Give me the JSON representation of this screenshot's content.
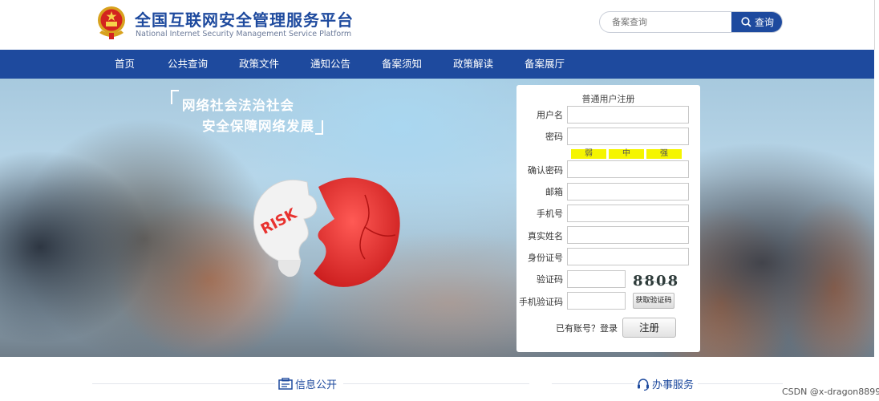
{
  "header": {
    "title": "全国互联网安全管理服务平台",
    "subtitle": "National Internet Security Management Service Platform",
    "search_placeholder": "备案查询",
    "search_button": "查询"
  },
  "nav": {
    "items": [
      "首页",
      "公共查询",
      "政策文件",
      "通知公告",
      "备案须知",
      "政策解读",
      "备案展厅"
    ]
  },
  "hero": {
    "slogan_line1": "网络社会法治社会",
    "slogan_line2": "安全保障网络发展",
    "puzzle_text": "RISK"
  },
  "register_form": {
    "title": "普通用户注册",
    "labels": {
      "username": "用户名",
      "password": "密码",
      "confirm_password": "确认密码",
      "email": "邮箱",
      "phone": "手机号",
      "real_name": "真实姓名",
      "id_number": "身份证号",
      "captcha": "验证码",
      "sms_code": "手机验证码"
    },
    "strength": [
      "弱",
      "中",
      "强"
    ],
    "captcha_image_text": "8808",
    "sms_button": "获取验证码",
    "login_link": "已有账号？登录",
    "submit_button": "注册"
  },
  "sections": {
    "info_public": "信息公开",
    "services": "办事服务"
  },
  "watermark": "CSDN @x-dragon8899",
  "colors": {
    "brand_blue": "#1e4a9e",
    "strength_yellow": "#f5f500",
    "puzzle_red": "#e8322f"
  }
}
